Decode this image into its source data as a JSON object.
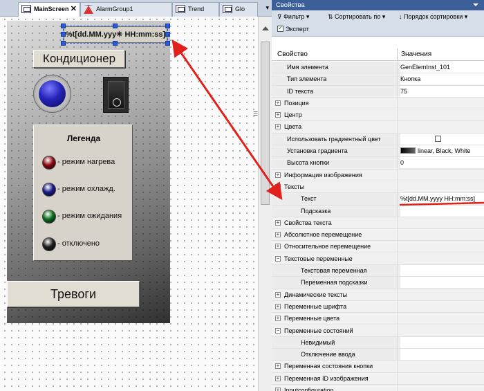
{
  "editor": {
    "tabs": [
      {
        "label": "MainScreen",
        "close": "✕"
      },
      {
        "label": "AlarmGroup1"
      },
      {
        "label": "Trend"
      },
      {
        "label": "Glo"
      }
    ],
    "tab_overflow": "▾",
    "datetime_text": "%t[dd.MM.yyy✳ HH:mm:ss]",
    "aircon_button": "Кондиционер",
    "legend": {
      "title": "Легенда",
      "items": [
        {
          "text": "- режим нагрева",
          "color": "#8b0a14"
        },
        {
          "text": "- режим охлажд.",
          "color": "#1a1a8a"
        },
        {
          "text": "- режим ожидания",
          "color": "#0a6e1e"
        },
        {
          "text": "- отключено",
          "color": "#1e1e1e"
        }
      ]
    },
    "alarms_button": "Тревоги",
    "splitter_glyph": "☰"
  },
  "properties": {
    "panel_title": "Свойства",
    "toolbar": {
      "filter": "Фильтр ▾",
      "sort": "Сортировать по ▾",
      "order": "Порядок сортировки ▾",
      "expert": "Эксперт",
      "expert_checked": true
    },
    "header": {
      "property": "Свойство",
      "value": "Значения"
    },
    "rows": [
      {
        "kind": "sub",
        "label": "Имя элемента",
        "value": "GenElemInst_101",
        "indent": 1
      },
      {
        "kind": "sub",
        "label": "Тип элемента",
        "value": "Кнопка",
        "indent": 1
      },
      {
        "kind": "sub",
        "label": "ID текста",
        "value": "75",
        "indent": 1
      },
      {
        "kind": "cat",
        "label": "Позиция",
        "exp": "+"
      },
      {
        "kind": "cat",
        "label": "Центр",
        "exp": "+"
      },
      {
        "kind": "cat",
        "label": "Цвета",
        "exp": "+"
      },
      {
        "kind": "sub",
        "label": "Использовать градиентный цвет",
        "value": "",
        "checkbox": true,
        "indent": 1
      },
      {
        "kind": "sub",
        "label": "Установка градиента",
        "value": "linear, Black, White",
        "swatch": true,
        "indent": 1
      },
      {
        "kind": "sub",
        "label": "Высота кнопки",
        "value": "0",
        "indent": 1
      },
      {
        "kind": "cat",
        "label": "Информация изображения",
        "exp": "+"
      },
      {
        "kind": "cat",
        "label": "Тексты",
        "exp": "−"
      },
      {
        "kind": "sub",
        "label": "Текст",
        "value": "%t[dd.MM.yyyy HH:mm:ss]",
        "indent": 2
      },
      {
        "kind": "sub",
        "label": "Подсказка",
        "value": "",
        "indent": 2
      },
      {
        "kind": "cat",
        "label": "Свойства текста",
        "exp": "+"
      },
      {
        "kind": "cat",
        "label": "Абсолютное перемещение",
        "exp": "+"
      },
      {
        "kind": "cat",
        "label": "Относительное перемещение",
        "exp": "+"
      },
      {
        "kind": "cat",
        "label": "Текстовые переменные",
        "exp": "−"
      },
      {
        "kind": "sub",
        "label": "Текстовая переменная",
        "value": "",
        "indent": 2
      },
      {
        "kind": "sub",
        "label": "Переменная подсказки",
        "value": "",
        "indent": 2
      },
      {
        "kind": "cat",
        "label": "Динамические тексты",
        "exp": "+"
      },
      {
        "kind": "cat",
        "label": "Переменные шрифта",
        "exp": "+"
      },
      {
        "kind": "cat",
        "label": "Переменные цвета",
        "exp": "+"
      },
      {
        "kind": "cat",
        "label": "Переменные состояний",
        "exp": "−"
      },
      {
        "kind": "sub",
        "label": "Невидимый",
        "value": "",
        "indent": 2
      },
      {
        "kind": "sub",
        "label": "Отключение ввода",
        "value": "",
        "indent": 2
      },
      {
        "kind": "cat",
        "label": "Переменная состояния кнопки",
        "exp": "+"
      },
      {
        "kind": "cat",
        "label": "Переменная ID изображения",
        "exp": "+"
      },
      {
        "kind": "cat",
        "label": "Inputconfiguration",
        "exp": "+"
      }
    ]
  },
  "annotation_color": "#e0201a"
}
